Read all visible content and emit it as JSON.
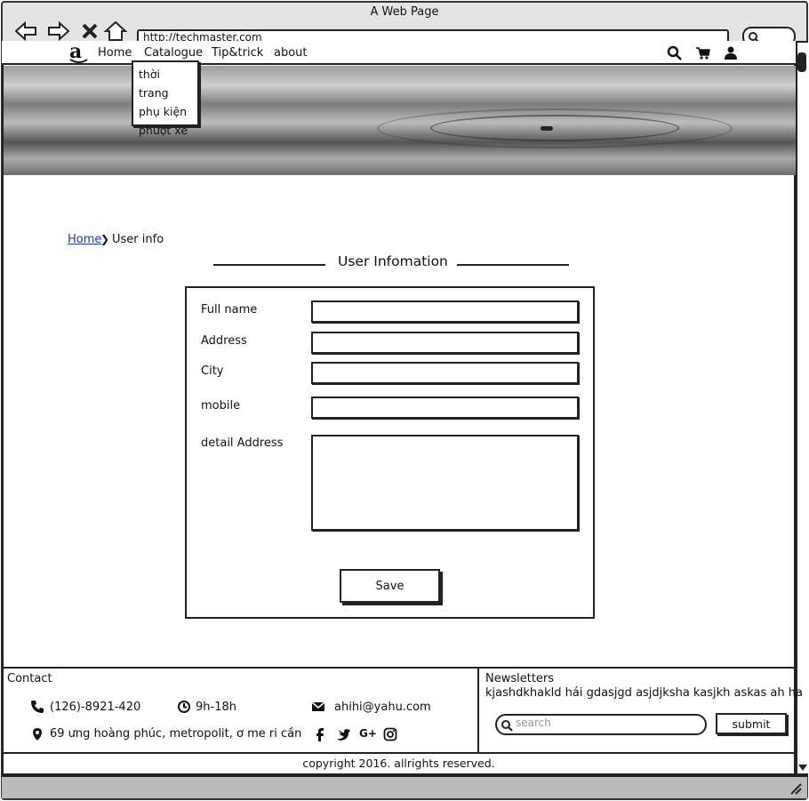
{
  "window": {
    "title": "A Web Page",
    "url": "http://techmaster.com"
  },
  "nav": {
    "logo": "a",
    "links": [
      "Home",
      "Catalogue",
      "Tip&trick",
      "about"
    ],
    "dropdown": [
      "thời trang",
      "phụ kiện",
      "phượt xe"
    ]
  },
  "breadcrumb": {
    "home": "Home",
    "sep": "❯",
    "current": "User info"
  },
  "section_title": "User Infomation",
  "form": {
    "fields": [
      "Full name",
      "Address",
      "City",
      "mobile",
      "detail Address"
    ],
    "save_label": "Save"
  },
  "footer": {
    "contact_title": "Contact",
    "phone": "(126)-8921-420",
    "hours": "9h-18h",
    "email": "ahihi@yahu.com",
    "address": "69 ưng hoàng phúc, metropolit, ơ me ri cần",
    "social": [
      "f",
      "twitter",
      "G+",
      "instagram"
    ],
    "newsletter_title": "Newsletters",
    "newsletter_text": "kjashdkhakld hái gdasjgd asjdjksha kasjkh askas ah ha",
    "search_placeholder": "search",
    "submit_label": "submit",
    "copyright": "copyright 2016. allrights reserved."
  },
  "colors": {
    "link": "#1a3e91",
    "border": "#222222"
  }
}
